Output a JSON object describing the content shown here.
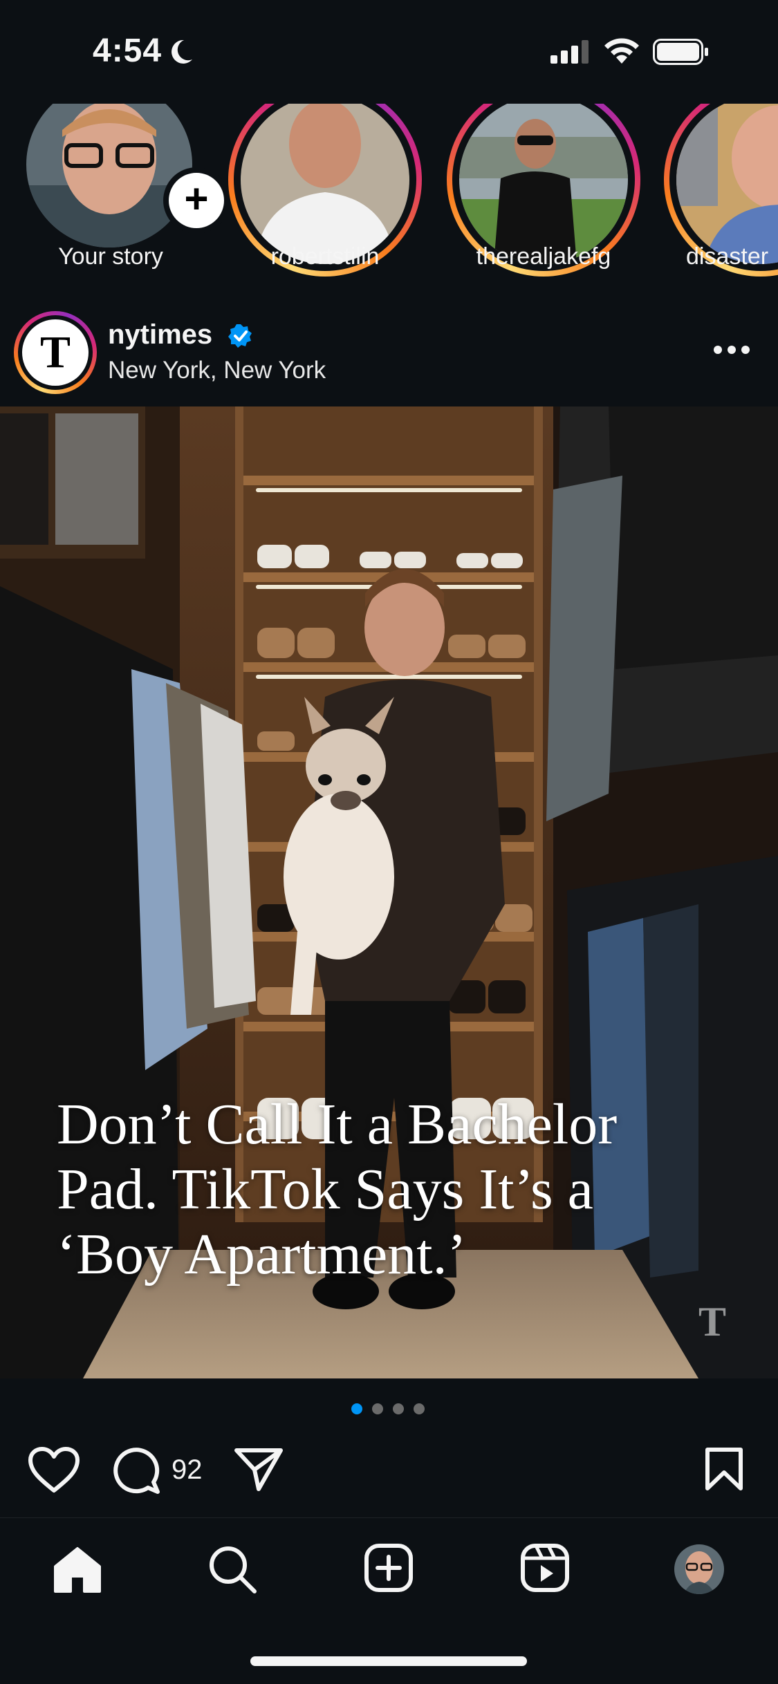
{
  "status_bar": {
    "time": "4:54"
  },
  "stories": [
    {
      "username": "Your story",
      "is_own": true
    },
    {
      "username": "robertstilin"
    },
    {
      "username": "therealjakefg"
    },
    {
      "username": "disaster"
    }
  ],
  "post": {
    "username": "nytimes",
    "verified": true,
    "location": "New York, New York",
    "avatar_letter": "T",
    "headline_lines": [
      "Don’t Call It a Bachelor",
      "Pad. TikTok Says It’s a",
      "‘Boy Apartment.’"
    ],
    "watermark": "T",
    "carousel": {
      "total": 4,
      "active": 1
    },
    "comment_count": "92"
  },
  "colors": {
    "background": "#0c1014",
    "text": "#f5f5f5",
    "verified": "#0095f6",
    "active_dot": "#0095f6",
    "inactive_dot": "#6b6b6b"
  },
  "nav": [
    "home-icon",
    "search-icon",
    "create-icon",
    "reels-icon",
    "profile-avatar"
  ]
}
